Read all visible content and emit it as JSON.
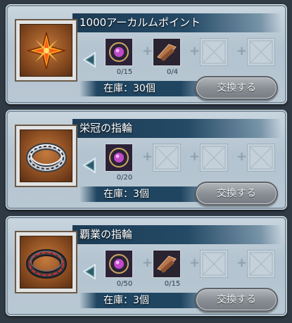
{
  "button_label": "交換する",
  "cards": [
    {
      "title": "1000アーカルムポイント",
      "item_icon": "arcarum-point-star-icon",
      "stock": "在庫：30個",
      "materials": [
        {
          "icon": "purple-gem-crest-icon",
          "count": "0/15"
        },
        {
          "icon": "bronze-fragment-icon",
          "count": "0/4"
        },
        {
          "icon": "empty-slot-icon",
          "count": ""
        },
        {
          "icon": "empty-slot-icon",
          "count": ""
        }
      ]
    },
    {
      "title": "栄冠の指輪",
      "item_icon": "silver-ring-icon",
      "stock": "在庫：3個",
      "materials": [
        {
          "icon": "purple-gem-crest-icon",
          "count": "0/20"
        },
        {
          "icon": "empty-slot-icon",
          "count": ""
        },
        {
          "icon": "empty-slot-icon",
          "count": ""
        },
        {
          "icon": "empty-slot-icon",
          "count": ""
        }
      ]
    },
    {
      "title": "覇業の指輪",
      "item_icon": "red-ring-icon",
      "stock": "在庫：3個",
      "materials": [
        {
          "icon": "purple-gem-crest-icon",
          "count": "0/50"
        },
        {
          "icon": "bronze-fragment-icon",
          "count": "0/15"
        },
        {
          "icon": "empty-slot-icon",
          "count": ""
        },
        {
          "icon": "empty-slot-icon",
          "count": ""
        }
      ]
    }
  ]
}
